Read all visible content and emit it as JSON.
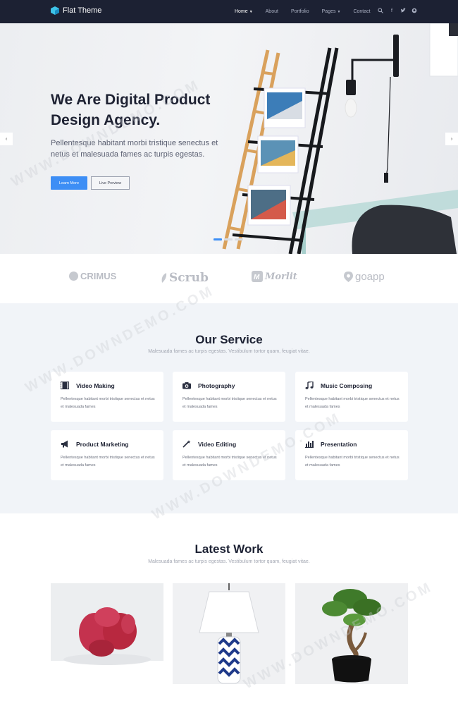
{
  "nav": {
    "brand": "Flat Theme",
    "links": [
      {
        "label": "Home",
        "active": true,
        "dropdown": true
      },
      {
        "label": "About",
        "active": false,
        "dropdown": false
      },
      {
        "label": "Portfolio",
        "active": false,
        "dropdown": false
      },
      {
        "label": "Pages",
        "active": false,
        "dropdown": true
      },
      {
        "label": "Contact",
        "active": false,
        "dropdown": false
      }
    ],
    "icons": [
      "search-icon",
      "facebook-icon",
      "twitter-icon",
      "github-icon"
    ]
  },
  "hero": {
    "title_line1": "We Are Digital Product",
    "title_line2": "Design Agency.",
    "subtitle": "Pellentesque habitant morbi tristique senectus et netus et malesuada fames ac turpis egestas.",
    "primary_button": "Learn More",
    "secondary_button": "Live Preview",
    "slide_count": 3,
    "active_slide": 1
  },
  "clients": [
    "CRIMUS",
    "Scrub",
    "Morlit",
    "goapp"
  ],
  "services": {
    "title": "Our Service",
    "subtitle": "Malesuada fames ac turpis egestas. Vestibulum tortor quam, feugiat vitae.",
    "cards": [
      {
        "title": "Video Making",
        "icon": "film-icon",
        "text": "Pellentesque habitant morbi tristique senectus et netus et malesuada fames"
      },
      {
        "title": "Photography",
        "icon": "camera-icon",
        "text": "Pellentesque habitant morbi tristique senectus et netus et malesuada fames"
      },
      {
        "title": "Music Composing",
        "icon": "music-icon",
        "text": "Pellentesque habitant morbi tristique senectus et netus et malesuada fames"
      },
      {
        "title": "Product Marketing",
        "icon": "megaphone-icon",
        "text": "Pellentesque habitant morbi tristique senectus et netus et malesuada fames"
      },
      {
        "title": "Video Editing",
        "icon": "magic-wand-icon",
        "text": "Pellentesque habitant morbi tristique senectus et netus et malesuada fames"
      },
      {
        "title": "Presentation",
        "icon": "bar-chart-icon",
        "text": "Pellentesque habitant morbi tristique senectus et netus et malesuada fames"
      }
    ]
  },
  "work": {
    "title": "Latest Work",
    "subtitle": "Malesuada fames ac turpis egestas. Vestibulum tortor quam, feugiat vitae.",
    "items": [
      "cactus-image",
      "lamp-image",
      "bonsai-image"
    ]
  },
  "watermark": "WWW.DOWNDEMO.COM",
  "colors": {
    "navbar": "#1c2133",
    "accent": "#3d8ef5",
    "section_bg": "#f1f4f8"
  }
}
